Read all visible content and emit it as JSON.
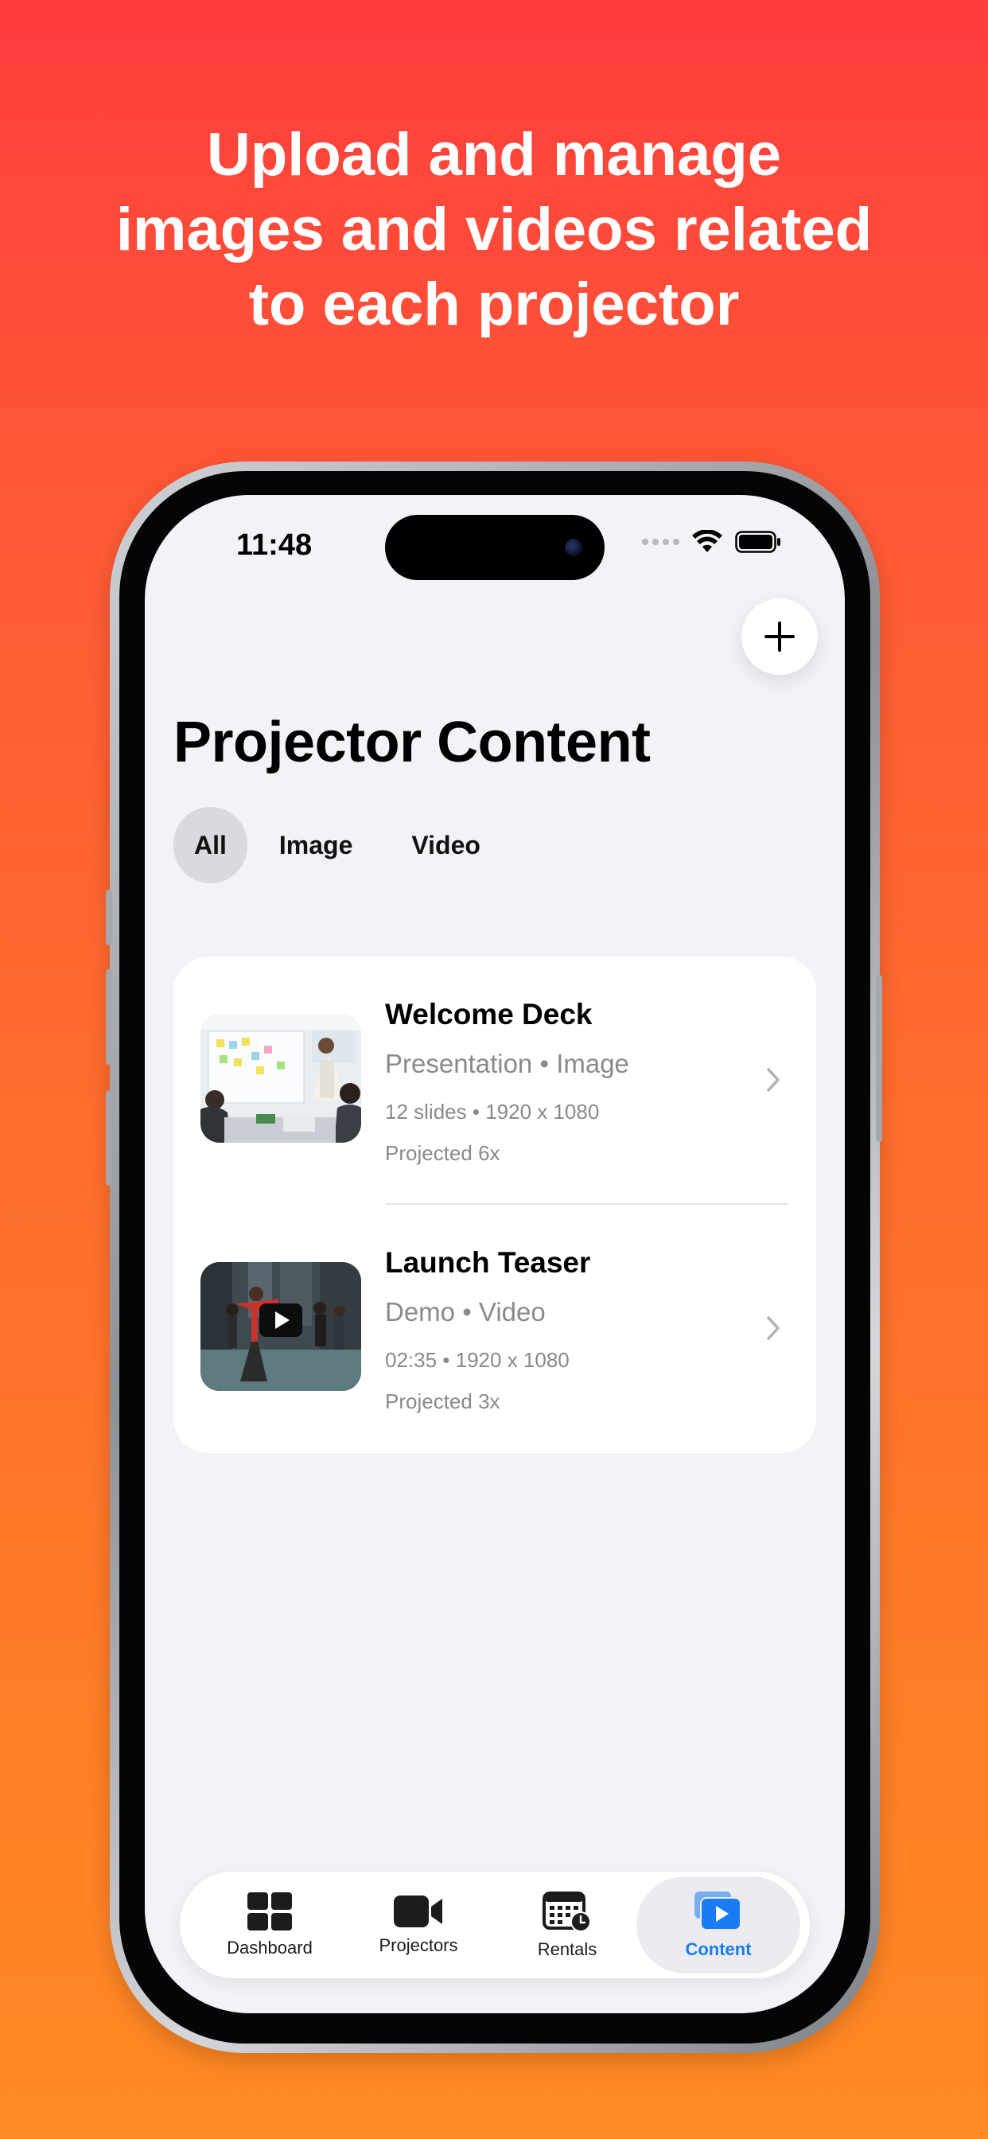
{
  "headline": {
    "line1": "Upload and manage",
    "line2": "images and videos related",
    "line3": "to each projector"
  },
  "status_bar": {
    "time": "11:48"
  },
  "header": {
    "title": "Projector Content",
    "add_icon": "plus-icon"
  },
  "filters": [
    {
      "label": "All",
      "selected": true
    },
    {
      "label": "Image",
      "selected": false
    },
    {
      "label": "Video",
      "selected": false
    }
  ],
  "content_items": [
    {
      "title": "Welcome Deck",
      "category": "Presentation",
      "type": "Image",
      "detail": "12 slides",
      "resolution": "1920 x 1080",
      "projected": "Projected 6x"
    },
    {
      "title": "Launch Teaser",
      "category": "Demo",
      "type": "Video",
      "detail": "02:35",
      "resolution": "1920 x 1080",
      "projected": "Projected 3x"
    }
  ],
  "tabbar": [
    {
      "label": "Dashboard",
      "icon": "dashboard-grid-icon",
      "active": false
    },
    {
      "label": "Projectors",
      "icon": "video-camera-icon",
      "active": false
    },
    {
      "label": "Rentals",
      "icon": "calendar-clock-icon",
      "active": false
    },
    {
      "label": "Content",
      "icon": "media-stack-play-icon",
      "active": true
    }
  ],
  "colors": {
    "accent": "#1a7cf2",
    "background_top": "#ff3d3d",
    "background_bottom": "#ff8a22"
  }
}
